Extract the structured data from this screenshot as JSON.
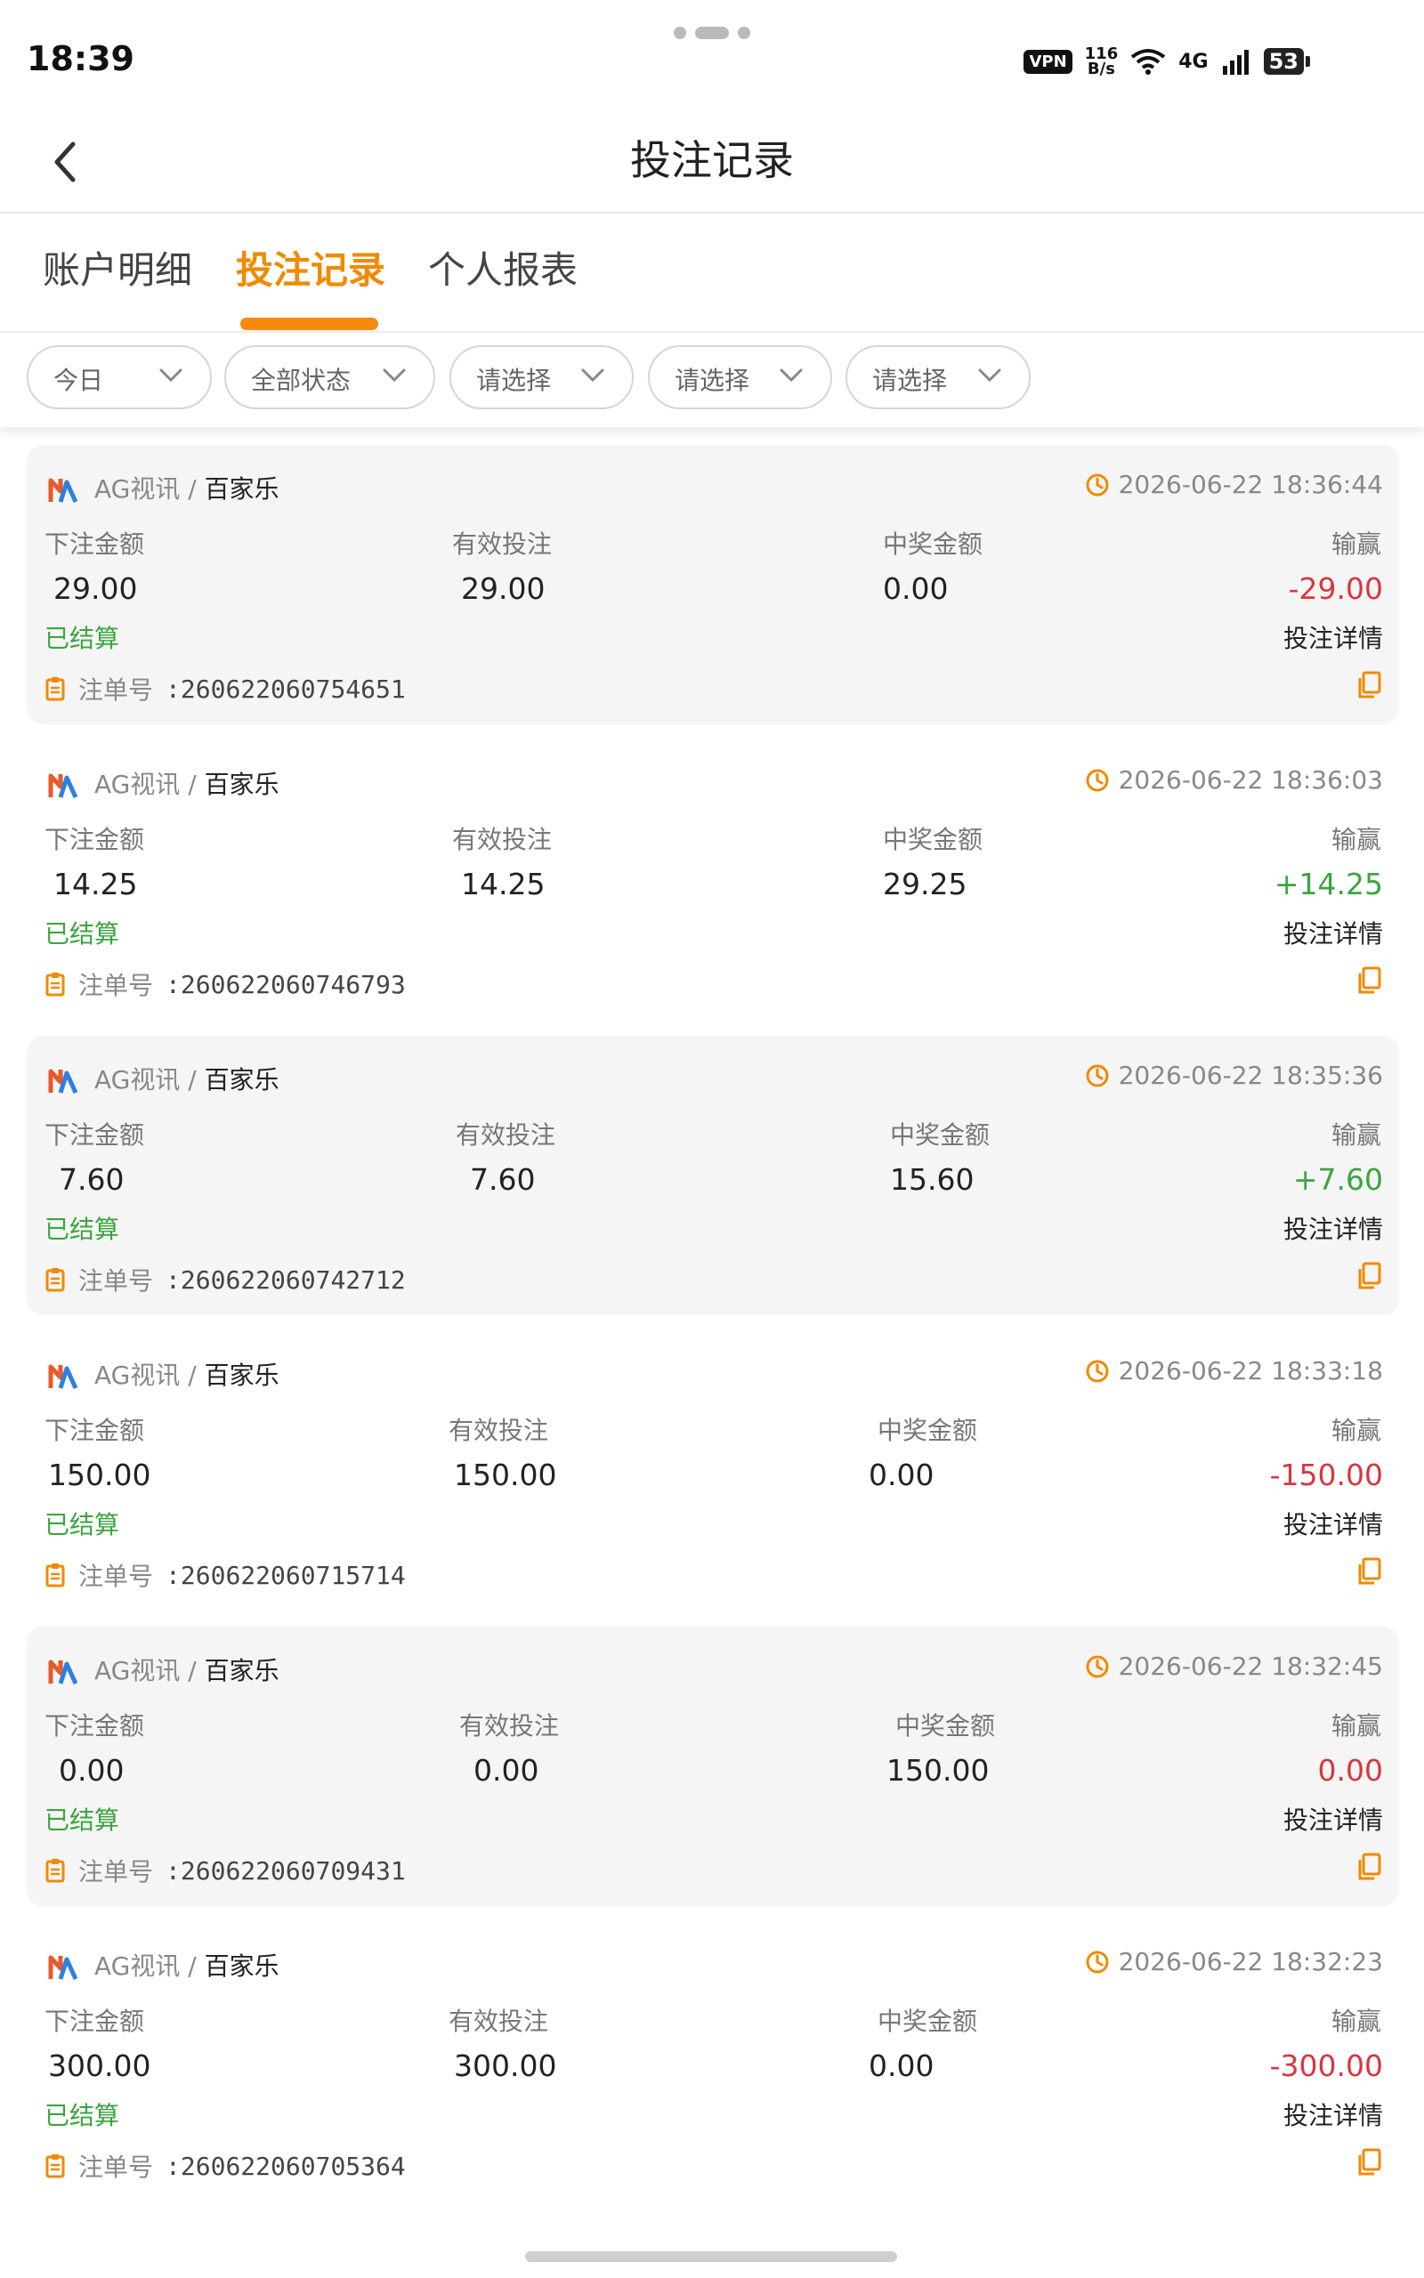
{
  "status_bar": {
    "time": "18:39",
    "vpn": "VPN",
    "speed_value": "116",
    "speed_unit": "B/s",
    "network": "4G",
    "battery": "53"
  },
  "header": {
    "title": "投注记录",
    "back_icon": "chevron-left-icon"
  },
  "tabs": [
    {
      "label": "账户明细",
      "active": false
    },
    {
      "label": "投注记录",
      "active": true
    },
    {
      "label": "个人报表",
      "active": false
    }
  ],
  "filters": [
    {
      "label": "今日"
    },
    {
      "label": "全部状态"
    },
    {
      "label": "请选择"
    },
    {
      "label": "请选择"
    },
    {
      "label": "请选择"
    }
  ],
  "labels": {
    "bet_amount": "下注金额",
    "valid_bet": "有效投注",
    "win_amount": "中奖金额",
    "profit": "输赢",
    "detail": "投注详情",
    "order_prefix": "注单号"
  },
  "colors": {
    "accent": "#f08a00",
    "loss": "#d9363e",
    "win": "#3aa53f"
  },
  "records": [
    {
      "provider": "AG视讯",
      "game": "百家乐",
      "time": "2026-06-22 18:36:44",
      "bet": "29.00",
      "valid": "29.00",
      "win": "0.00",
      "profit": "-29.00",
      "profit_type": "neg",
      "status": "已结算",
      "order_no": ":260622060754651"
    },
    {
      "provider": "AG视讯",
      "game": "百家乐",
      "time": "2026-06-22 18:36:03",
      "bet": "14.25",
      "valid": "14.25",
      "win": "29.25",
      "profit": "+14.25",
      "profit_type": "pos",
      "status": "已结算",
      "order_no": ":260622060746793"
    },
    {
      "provider": "AG视讯",
      "game": "百家乐",
      "time": "2026-06-22 18:35:36",
      "bet": "7.60",
      "valid": "7.60",
      "win": "15.60",
      "profit": "+7.60",
      "profit_type": "pos",
      "status": "已结算",
      "order_no": ":260622060742712"
    },
    {
      "provider": "AG视讯",
      "game": "百家乐",
      "time": "2026-06-22 18:33:18",
      "bet": "150.00",
      "valid": "150.00",
      "win": "0.00",
      "profit": "-150.00",
      "profit_type": "neg",
      "status": "已结算",
      "order_no": ":260622060715714"
    },
    {
      "provider": "AG视讯",
      "game": "百家乐",
      "time": "2026-06-22 18:32:45",
      "bet": "0.00",
      "valid": "0.00",
      "win": "150.00",
      "profit": "0.00",
      "profit_type": "neg",
      "status": "已结算",
      "order_no": ":260622060709431"
    },
    {
      "provider": "AG视讯",
      "game": "百家乐",
      "time": "2026-06-22 18:32:23",
      "bet": "300.00",
      "valid": "300.00",
      "win": "0.00",
      "profit": "-300.00",
      "profit_type": "neg",
      "status": "已结算",
      "order_no": ":260622060705364"
    }
  ]
}
